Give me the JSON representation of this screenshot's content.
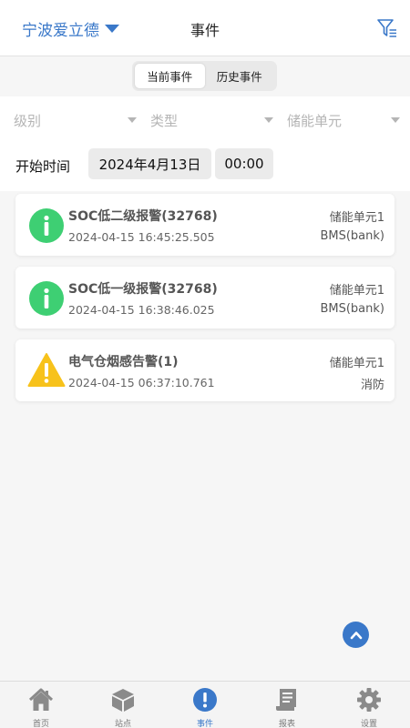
{
  "header": {
    "site_name": "宁波爱立德",
    "title": "事件",
    "filter_icon": "filter-icon"
  },
  "tabs": [
    {
      "label": "当前事件",
      "active": true
    },
    {
      "label": "历史事件",
      "active": false
    }
  ],
  "filters": {
    "level_placeholder": "级别",
    "type_placeholder": "类型",
    "unit_placeholder": "储能单元",
    "start_label": "开始时间",
    "start_date": "2024年4月13日",
    "start_time": "00:00"
  },
  "events": [
    {
      "icon": "info-icon",
      "title": "SOC低二级报警(32768)",
      "time": "2024-04-15 16:45:25.505",
      "unit": "储能单元1",
      "source": "BMS(bank)"
    },
    {
      "icon": "info-icon",
      "title": "SOC低一级报警(32768)",
      "time": "2024-04-15 16:38:46.025",
      "unit": "储能单元1",
      "source": "BMS(bank)"
    },
    {
      "icon": "warning-icon",
      "title": "电气仓烟感告警(1)",
      "time": "2024-04-15 06:37:10.761",
      "unit": "储能单元1",
      "source": "消防"
    }
  ],
  "nav": [
    {
      "label": "首页",
      "icon": "home-icon",
      "active": false
    },
    {
      "label": "站点",
      "icon": "cube-icon",
      "active": false
    },
    {
      "label": "事件",
      "icon": "alert-icon",
      "active": true
    },
    {
      "label": "报表",
      "icon": "report-icon",
      "active": false
    },
    {
      "label": "设置",
      "icon": "gear-icon",
      "active": false
    }
  ],
  "colors": {
    "accent": "#3a78c9",
    "info": "#3ecf73",
    "warning": "#f7c21b",
    "nav_inactive": "#8a8a8a"
  }
}
